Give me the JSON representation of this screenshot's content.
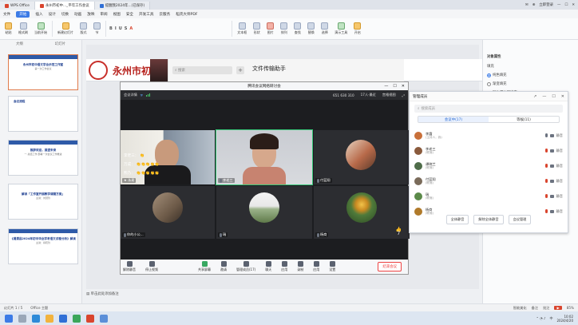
{
  "titlebar": {
    "tabs": [
      {
        "label": "WPS Office",
        "active": false
      },
      {
        "label": "永州市初中..._平年工作会议",
        "active": true
      },
      {
        "label": "提醒我2024年...(已保存)",
        "active": false
      }
    ],
    "right_items": [
      "✉",
      "⊕",
      "立即登录",
      "—",
      "☐",
      "✕"
    ]
  },
  "menu": {
    "items": [
      "文件",
      "开始",
      "插入",
      "设计",
      "切换",
      "动画",
      "放映",
      "审阅",
      "视图",
      "安全",
      "开发工具",
      "云服务",
      "稻壳大师PDF"
    ],
    "active_index": 1
  },
  "ribbon": {
    "left_buttons": [
      "粘贴",
      "格式刷",
      "当前开始",
      "新建幻灯片",
      "版式",
      "节"
    ],
    "format": [
      "B",
      "I",
      "U",
      "S",
      "A"
    ],
    "right_buttons": [
      "文本框",
      "形状",
      "图片",
      "排列",
      "查找",
      "替换",
      "选择",
      "演示工具",
      "开启"
    ]
  },
  "sidebar": {
    "headers": [
      "大纲",
      "幻灯片"
    ],
    "slides": [
      {
        "num": "1",
        "title": "永州市初中语文学业示范工作室",
        "sub": "第一次工作会议"
      },
      {
        "num": "2",
        "title": "会议流程",
        "sub": ""
      },
      {
        "num": "3",
        "title": "致辞欢迎，展望未来",
        "sub": "一·总结工作·部署一次会议工作推进"
      },
      {
        "num": "4",
        "title": "解读「工作室开展教学课题方案」",
        "sub": "主讲：刘慧玲"
      },
      {
        "num": "5",
        "title": "《湘潭县2024年初中毕业学考语文试卷分析》解读",
        "sub": "主讲：蒋晓玲"
      }
    ]
  },
  "web": {
    "site_name": "永州市初",
    "file_transfer_title": "文件传输助手",
    "search_placeholder": "搜索",
    "plus": "+"
  },
  "meeting": {
    "title": "腾讯会议网络研讨会",
    "info": {
      "left": "会议详情",
      "id": "651 630 310",
      "count": "17人·最近",
      "layout": "宫格视图"
    },
    "window_controls": [
      "—",
      "☐",
      "✕"
    ],
    "tiles": [
      {
        "name": "★ 永易",
        "type": "video_man"
      },
      {
        "name": "李老三",
        "type": "video_woman",
        "speaking": true
      },
      {
        "name": "付蓝翔",
        "type": "avatar_books"
      },
      {
        "name": "你的小公...",
        "type": "avatar_group"
      },
      {
        "name": "瑞",
        "type": "avatar_landscape"
      },
      {
        "name": "杨商",
        "type": "avatar_garden"
      }
    ],
    "chat": [
      {
        "name": "李老三：",
        "emoji": "👏"
      },
      {
        "name": "万成：",
        "emoji": "👏👏👏👏👏"
      },
      {
        "name": "熊乃：",
        "emoji": "👏👏👏👏👏"
      }
    ],
    "toolbar": [
      "解除静音",
      "停止视频",
      "共享屏幕",
      "邀请",
      "管理成员(17)",
      "聊天",
      "应用",
      "录制",
      "应用",
      "设置"
    ],
    "end_button": "结束会议",
    "thumb_counter": "7"
  },
  "members": {
    "title": "管理成员",
    "window_controls": [
      "↗",
      "—",
      "☐",
      "✕"
    ],
    "search_placeholder": "搜索成员",
    "tabs": [
      "会议中(17)",
      "等候(11)"
    ],
    "list": [
      {
        "name": "李霞",
        "role": "(主持人，我)",
        "avatar_color": "#c9703a",
        "mic_off": false
      },
      {
        "name": "李老三",
        "role": "(联席)",
        "avatar_color": "#8a5a3c",
        "mic_off": true
      },
      {
        "name": "谭晓兰",
        "role": "(联席)",
        "avatar_color": "#4f6d4a",
        "mic_off": true
      },
      {
        "name": "付蓝翔",
        "role": "(联席)",
        "avatar_color": "#7a6b5a",
        "mic_off": true
      },
      {
        "name": "瑞",
        "role": "(联席)",
        "avatar_color": "#5c8a4a",
        "mic_off": true
      },
      {
        "name": "杨商",
        "role": "(联席)",
        "avatar_color": "#b07a2a",
        "mic_off": true
      }
    ],
    "row_action": "静音",
    "buttons": [
      "全体静音",
      "解除全体静音",
      "会议管理"
    ]
  },
  "recording": {
    "text": "正在录制",
    "host": "李老三",
    "pause": "‖"
  },
  "right_pane": {
    "title": "对象属性",
    "options": [
      "填充",
      "纯色填充",
      "渐变填充",
      "图片或纹理填充",
      "图案填充",
      "隐藏背景图形"
    ],
    "selected_index": 1
  },
  "slide_caption": "单击此处添加备注",
  "statusbar": {
    "slide_info": "幻灯片 1 / 5",
    "theme": "Office 主题",
    "right": [
      "智能美化",
      "备注",
      "批注"
    ],
    "zoom": "85%"
  },
  "taskbar": {
    "time": "10:02",
    "date": "2024/4/20",
    "lang": "中"
  }
}
